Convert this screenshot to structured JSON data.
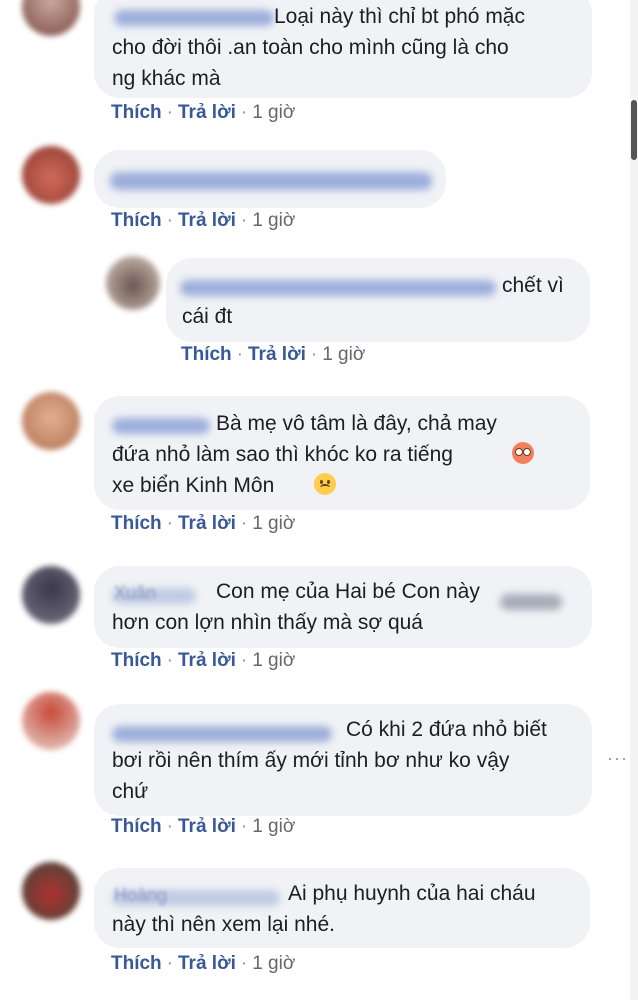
{
  "comments": [
    {
      "text": "Loại này thì chỉ bt phó mặc\ncho đời thôi .an toàn cho mình cũng là cho\nng khác mà",
      "actions": {
        "like": "Thích",
        "reply": "Trả lời",
        "time": "1 giờ"
      }
    },
    {
      "text": "",
      "actions": {
        "like": "Thích",
        "reply": "Trả lời",
        "time": "1 giờ"
      }
    },
    {
      "text": "chết vì\ncái đt",
      "actions": {
        "like": "Thích",
        "reply": "Trả lời",
        "time": "1 giờ"
      }
    },
    {
      "text": "Bà mẹ vô tâm là đây, chả may\nđứa nhỏ làm sao thì khóc ko ra tiếng\nxe biển Kinh Môn",
      "actions": {
        "like": "Thích",
        "reply": "Trả lời",
        "time": "1 giờ"
      }
    },
    {
      "name": "Xuân",
      "text": "Con mẹ của Hai bé Con này\nhơn con lợn nhìn thấy mà sợ quá",
      "actions": {
        "like": "Thích",
        "reply": "Trả lời",
        "time": "1 giờ"
      }
    },
    {
      "text": "Có khi 2 đứa nhỏ biết\nbơi rồi nên thím ấy mới tỉnh bơ như ko vậy\nchứ",
      "actions": {
        "like": "Thích",
        "reply": "Trả lời",
        "time": "1 giờ"
      }
    },
    {
      "name": "Hoàng",
      "text": "Ai phụ huynh của hai cháu\nnày thì nên xem lại nhé.",
      "actions": {
        "like": "Thích",
        "reply": "Trả lời",
        "time": "1 giờ"
      }
    }
  ],
  "separator": "·",
  "more_dots": "···",
  "icons": [
    "flushed-face-icon",
    "sad-face-icon"
  ],
  "colors": {
    "bubble": "#f0f2f5",
    "link": "#385898",
    "meta": "#65676b"
  }
}
